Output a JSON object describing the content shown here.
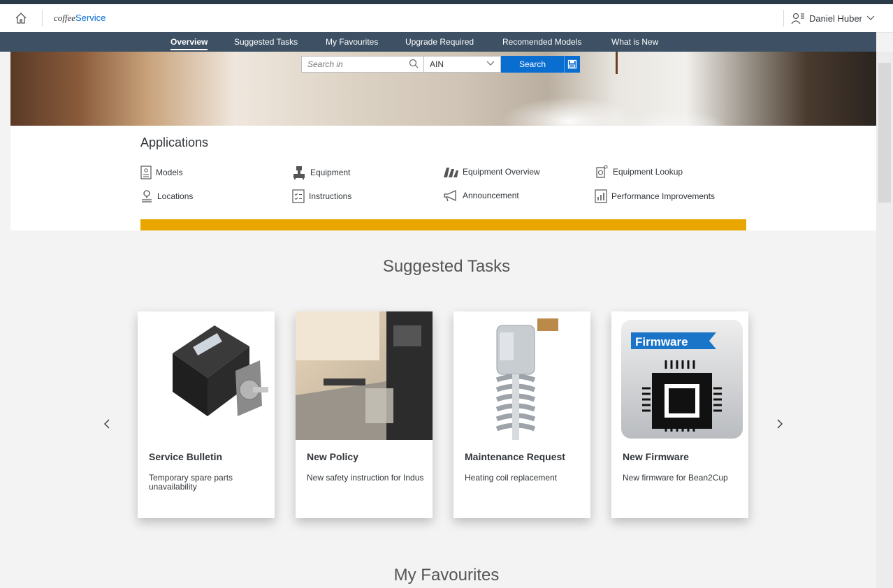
{
  "shell": {
    "logo_prefix": "coffee",
    "logo_suffix": "Service",
    "user_name": "Daniel Huber"
  },
  "nav": {
    "items": [
      {
        "label": "Overview",
        "active": true
      },
      {
        "label": "Suggested Tasks"
      },
      {
        "label": "My Favourites"
      },
      {
        "label": "Upgrade Required"
      },
      {
        "label": "Recomended Models"
      },
      {
        "label": "What is New"
      }
    ]
  },
  "search": {
    "placeholder": "Search in",
    "scope": "AIN",
    "button": "Search"
  },
  "applications": {
    "title": "Applications",
    "items": [
      {
        "label": "Models",
        "icon": "document-icon"
      },
      {
        "label": "Equipment",
        "icon": "machine-icon"
      },
      {
        "label": "Equipment Overview",
        "icon": "factory-icon"
      },
      {
        "label": "Equipment Lookup",
        "icon": "lookup-icon"
      },
      {
        "label": "Locations",
        "icon": "location-icon"
      },
      {
        "label": "Instructions",
        "icon": "checklist-icon"
      },
      {
        "label": "Announcement",
        "icon": "megaphone-icon"
      },
      {
        "label": "Performance Improvements",
        "icon": "chart-document-icon"
      }
    ]
  },
  "suggested": {
    "title": "Suggested Tasks",
    "cards": [
      {
        "title": "Service Bulletin",
        "desc": "Temporary spare parts unavailability",
        "image": "stepper-motor"
      },
      {
        "title": "New Policy",
        "desc": "New safety instruction for Indus",
        "image": "coffee-machine-kitchen"
      },
      {
        "title": "Maintenance Request",
        "desc": "Heating coil replacement",
        "image": "heating-coil"
      },
      {
        "title": "New Firmware",
        "desc": "New firmware for Bean2Cup",
        "image": "firmware-chip",
        "image_label": "Firmware"
      }
    ]
  },
  "favourites": {
    "title": "My Favourites"
  },
  "colors": {
    "nav_bg": "#3d5064",
    "accent": "#0a6ed1",
    "highlight_bar": "#e9a500",
    "page_bg": "#f3f3f3"
  }
}
